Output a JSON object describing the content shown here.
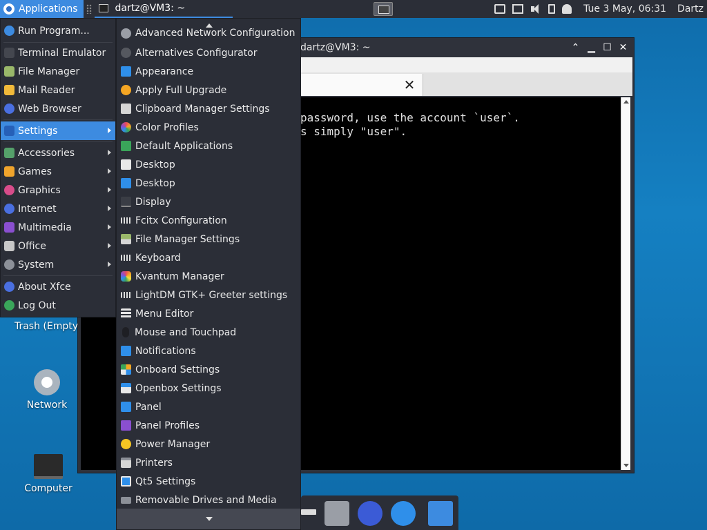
{
  "top_panel": {
    "applications_label": "Applications",
    "task_title": "dartz@VM3: ~",
    "clock": "Tue  3 May, 06:31",
    "user": "Dartz"
  },
  "terminal": {
    "title": "dartz@VM3: ~",
    "lines": [
      "password, use the account `user`.",
      "s simply \"user\"."
    ]
  },
  "desktop": {
    "icons": [
      {
        "label": "Trash (Empty"
      },
      {
        "label": "Network"
      },
      {
        "label": "Computer"
      }
    ]
  },
  "app_menu": {
    "items": [
      {
        "label": "Run Program...",
        "icon": "run-icon"
      },
      {
        "label": "Terminal Emulator",
        "icon": "terminal-icon"
      },
      {
        "label": "File Manager",
        "icon": "folder-icon"
      },
      {
        "label": "Mail Reader",
        "icon": "mail-icon"
      },
      {
        "label": "Web Browser",
        "icon": "browser-icon"
      },
      {
        "label": "Settings",
        "icon": "settings-icon",
        "submenu": true,
        "active": true
      },
      {
        "label": "Accessories",
        "icon": "accessories-icon",
        "submenu": true
      },
      {
        "label": "Games",
        "icon": "games-icon",
        "submenu": true
      },
      {
        "label": "Graphics",
        "icon": "graphics-icon",
        "submenu": true
      },
      {
        "label": "Internet",
        "icon": "internet-icon",
        "submenu": true
      },
      {
        "label": "Multimedia",
        "icon": "multimedia-icon",
        "submenu": true
      },
      {
        "label": "Office",
        "icon": "office-icon",
        "submenu": true
      },
      {
        "label": "System",
        "icon": "system-icon",
        "submenu": true
      },
      {
        "label": "About Xfce",
        "icon": "about-icon"
      },
      {
        "label": "Log Out",
        "icon": "logout-icon"
      }
    ]
  },
  "settings_menu": {
    "items": [
      {
        "label": "Advanced Network Configuration",
        "icon": "network-config-icon"
      },
      {
        "label": "Alternatives Configurator",
        "icon": "alternatives-icon"
      },
      {
        "label": "Appearance",
        "icon": "appearance-icon"
      },
      {
        "label": "Apply Full Upgrade",
        "icon": "upgrade-icon"
      },
      {
        "label": "Clipboard Manager Settings",
        "icon": "clipboard-icon"
      },
      {
        "label": "Color Profiles",
        "icon": "color-profiles-icon"
      },
      {
        "label": "Default Applications",
        "icon": "default-apps-icon"
      },
      {
        "label": "Desktop",
        "icon": "desktop-icon"
      },
      {
        "label": "Desktop",
        "icon": "desktop-blue-icon"
      },
      {
        "label": "Display",
        "icon": "display-icon"
      },
      {
        "label": "Fcitx Configuration",
        "icon": "keyboard-icon"
      },
      {
        "label": "File Manager Settings",
        "icon": "file-manager-settings-icon"
      },
      {
        "label": "Keyboard",
        "icon": "keyboard-icon"
      },
      {
        "label": "Kvantum Manager",
        "icon": "kvantum-icon"
      },
      {
        "label": "LightDM GTK+ Greeter settings",
        "icon": "lightdm-icon"
      },
      {
        "label": "Menu Editor",
        "icon": "menu-editor-icon"
      },
      {
        "label": "Mouse and Touchpad",
        "icon": "mouse-icon"
      },
      {
        "label": "Notifications",
        "icon": "notifications-icon"
      },
      {
        "label": "Onboard Settings",
        "icon": "onboard-icon"
      },
      {
        "label": "Openbox Settings",
        "icon": "openbox-icon"
      },
      {
        "label": "Panel",
        "icon": "panel-icon"
      },
      {
        "label": "Panel Profiles",
        "icon": "panel-profiles-icon"
      },
      {
        "label": "Power Manager",
        "icon": "power-icon"
      },
      {
        "label": "Printers",
        "icon": "printer-icon"
      },
      {
        "label": "Qt5 Settings",
        "icon": "qt5-icon"
      },
      {
        "label": "Removable Drives and Media",
        "icon": "removable-drive-icon"
      }
    ]
  },
  "colors": {
    "accent": "#3d8be0",
    "panel": "#2b2e37",
    "desktop": "#1580c2"
  }
}
